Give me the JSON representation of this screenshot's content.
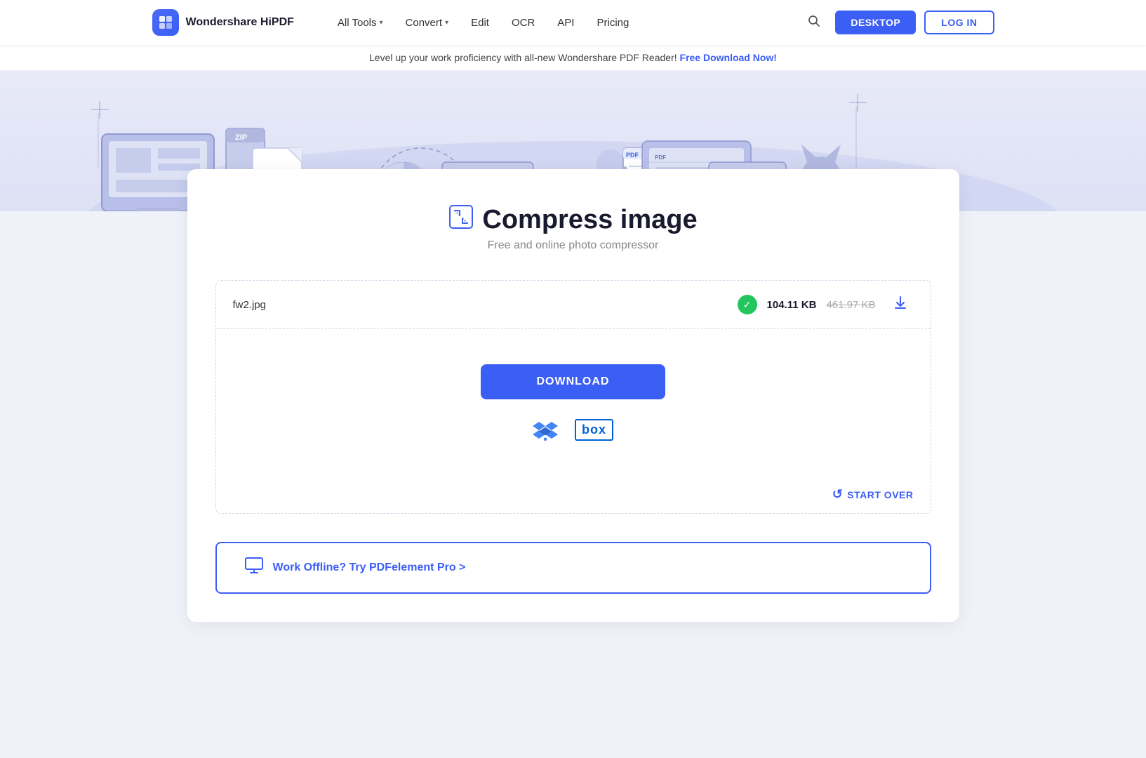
{
  "nav": {
    "logo_text": "Wondershare HiPDF",
    "links": [
      {
        "label": "All Tools",
        "has_chevron": true,
        "id": "all-tools"
      },
      {
        "label": "Convert",
        "has_chevron": true,
        "id": "convert"
      },
      {
        "label": "Edit",
        "has_chevron": false,
        "id": "edit"
      },
      {
        "label": "OCR",
        "has_chevron": false,
        "id": "ocr"
      },
      {
        "label": "API",
        "has_chevron": false,
        "id": "api"
      },
      {
        "label": "Pricing",
        "has_chevron": false,
        "id": "pricing"
      }
    ],
    "desktop_btn": "DESKTOP",
    "login_btn": "LOG IN"
  },
  "banner": {
    "text": "Level up your work proficiency with all-new Wondershare PDF Reader!",
    "link_text": "Free Download Now!"
  },
  "page": {
    "title": "Compress image",
    "subtitle": "Free and online photo compressor"
  },
  "file": {
    "name": "fw2.jpg",
    "compressed_size": "104.11 KB",
    "original_size": "461.97 KB"
  },
  "actions": {
    "download_btn": "DOWNLOAD",
    "start_over_btn": "START OVER"
  },
  "offline": {
    "text": "Work Offline? Try PDFelement Pro >"
  }
}
